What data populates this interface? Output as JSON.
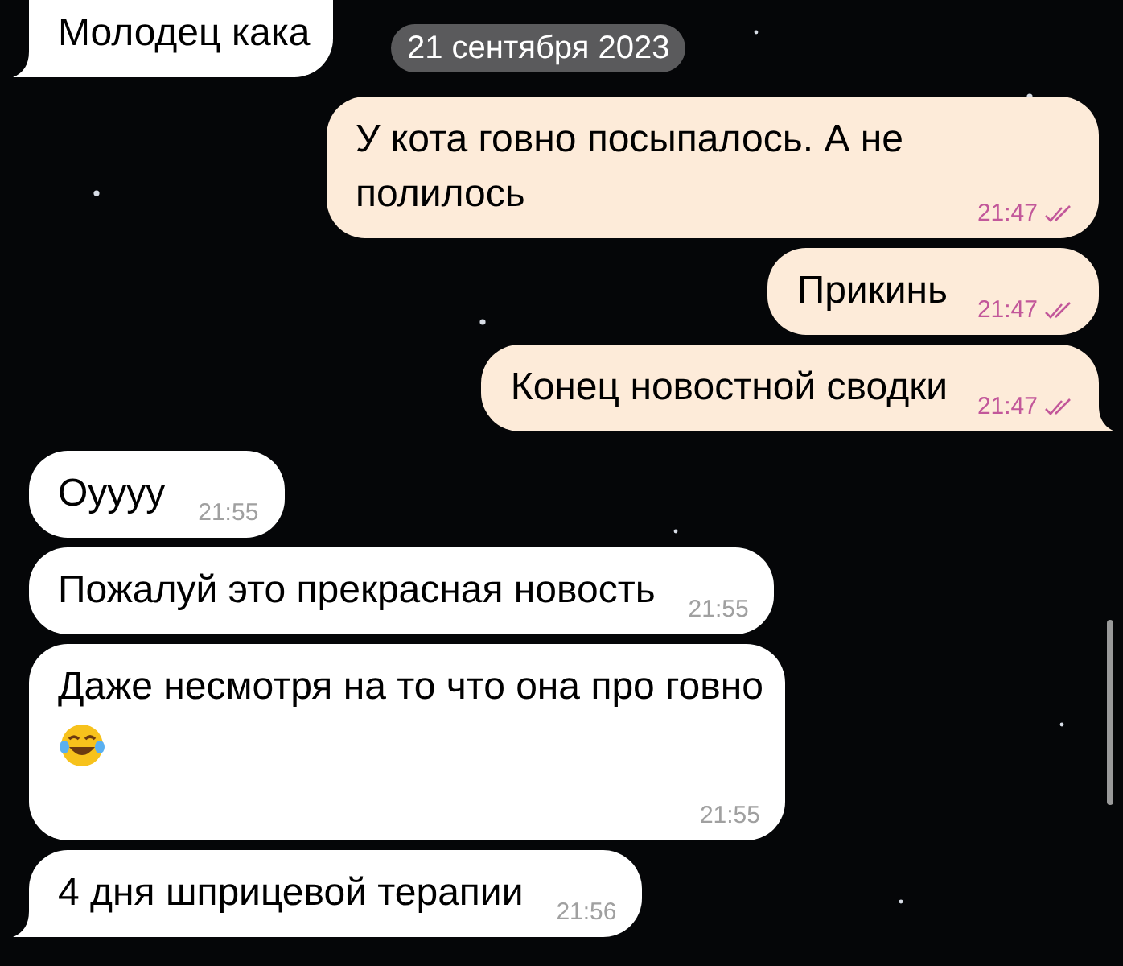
{
  "date_label": "21 сентября 2023",
  "messages": [
    {
      "kind": "incoming",
      "text": "Молодец кака",
      "tail": true,
      "cut": true,
      "emoji": false
    },
    {
      "kind": "outgoing",
      "text": "У кота говно посыпалось. А не полилось",
      "time": "21:47",
      "read": true,
      "tail": false,
      "cut": false,
      "emoji": false
    },
    {
      "kind": "outgoing",
      "text": "Прикинь",
      "time": "21:47",
      "read": true,
      "tail": false,
      "cut": false,
      "emoji": false
    },
    {
      "kind": "outgoing",
      "text": "Конец новостной сводки",
      "time": "21:47",
      "read": true,
      "tail": true,
      "cut": false,
      "emoji": false
    },
    {
      "kind": "incoming",
      "text": "Оуууу",
      "time": "21:55",
      "tail": false,
      "cut": false,
      "emoji": false
    },
    {
      "kind": "incoming",
      "text": "Пожалуй это прекрасная новость",
      "time": "21:55",
      "tail": false,
      "cut": false,
      "emoji": false
    },
    {
      "kind": "incoming",
      "text": "Даже несмотря на то что она про говно",
      "time": "21:55",
      "tail": false,
      "cut": false,
      "emoji": true
    },
    {
      "kind": "incoming",
      "text": "4 дня шприцевой терапии",
      "time": "21:56",
      "tail": true,
      "cut": false,
      "emoji": false
    }
  ]
}
